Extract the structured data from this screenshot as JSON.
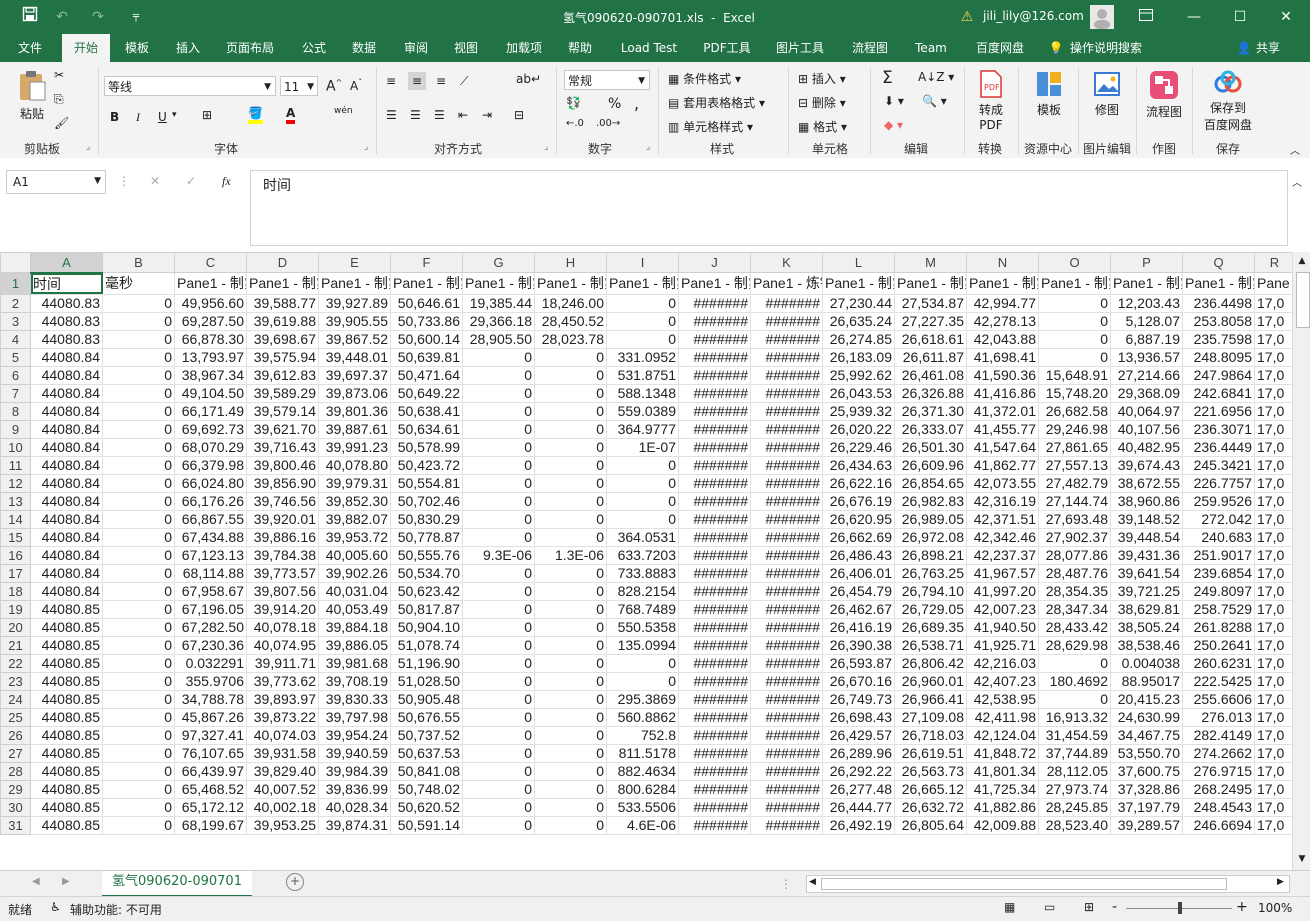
{
  "app": {
    "file_title": "氢气090620-090701.xls",
    "app_name": "Excel",
    "title_sep": "-",
    "account": "jili_lily@126.com",
    "qat_dropdown": "╤"
  },
  "tabs": [
    "文件",
    "开始",
    "模板",
    "插入",
    "页面布局",
    "公式",
    "数据",
    "审阅",
    "视图",
    "加载项",
    "帮助",
    "Load Test",
    "PDF工具",
    "图片工具",
    "流程图",
    "Team",
    "百度网盘"
  ],
  "tell_me": "操作说明搜索",
  "share": "共享",
  "ribbon": {
    "paste": "粘贴",
    "clipboard": "剪贴板",
    "font_name": "等线",
    "font_size": "11",
    "font_group": "字体",
    "align_group": "对齐方式",
    "number_format": "常规",
    "number_group": "数字",
    "cond_format": "条件格式",
    "table_format": "套用表格格式",
    "cell_style": "单元格样式",
    "style_group": "样式",
    "insert": "插入",
    "delete": "删除",
    "format": "格式",
    "cells_group": "单元格",
    "edit_group": "编辑",
    "to_pdf_1": "转成",
    "to_pdf_2": "PDF",
    "convert_group": "转换",
    "template": "模板",
    "resource_group": "资源中心",
    "fix_img": "修图",
    "img_edit_group": "图片编辑",
    "flowchart": "流程图",
    "draw_group": "作图",
    "save_baidu_1": "保存到",
    "save_baidu_2": "百度网盘",
    "save_group": "保存",
    "bold": "B",
    "italic": "I",
    "underline": "U",
    "percent": "%",
    "comma": ",",
    "wen": "wén",
    "sigma": "Σ"
  },
  "formula_bar": {
    "name_box": "A1",
    "fx": "fx",
    "content": "时间"
  },
  "columns": [
    "A",
    "B",
    "C",
    "D",
    "E",
    "F",
    "G",
    "H",
    "I",
    "J",
    "K",
    "L",
    "M",
    "N",
    "O",
    "P",
    "Q",
    "R"
  ],
  "header_row": [
    "时间",
    "毫秒",
    "Pane1 - 制氢",
    "Pane1 - 制氢",
    "Pane1 - 制氢",
    "Pane1 - 制氢",
    "Pane1 - 制氢",
    "Pane1 - 制氢",
    "Pane1 - 制氢",
    "Pane1 - 制氢",
    "Pane1 - 炼钢",
    "Pane1 - 制氢",
    "Pane1 - 制氢",
    "Pane1 - 制氢",
    "Pane1 - 制氢",
    "Pane1 - 制氢",
    "Pane1 - 制氢",
    "Pane"
  ],
  "rows": [
    [
      "44080.83",
      "0",
      "49,956.60",
      "39,588.77",
      "39,927.89",
      "50,646.61",
      "19,385.44",
      "18,246.00",
      "0",
      "#######",
      "#######",
      "27,230.44",
      "27,534.87",
      "42,994.77",
      "0",
      "12,203.43",
      "236.4498",
      "17,0"
    ],
    [
      "44080.83",
      "0",
      "69,287.50",
      "39,619.88",
      "39,905.55",
      "50,733.86",
      "29,366.18",
      "28,450.52",
      "0",
      "#######",
      "#######",
      "26,635.24",
      "27,227.35",
      "42,278.13",
      "0",
      "5,128.07",
      "253.8058",
      "17,0"
    ],
    [
      "44080.83",
      "0",
      "66,878.30",
      "39,698.67",
      "39,867.52",
      "50,600.14",
      "28,905.50",
      "28,023.78",
      "0",
      "#######",
      "#######",
      "26,274.85",
      "26,618.61",
      "42,043.88",
      "0",
      "6,887.19",
      "235.7598",
      "17,0"
    ],
    [
      "44080.84",
      "0",
      "13,793.97",
      "39,575.94",
      "39,448.01",
      "50,639.81",
      "0",
      "0",
      "331.0952",
      "#######",
      "#######",
      "26,183.09",
      "26,611.87",
      "41,698.41",
      "0",
      "13,936.57",
      "248.8095",
      "17,0"
    ],
    [
      "44080.84",
      "0",
      "38,967.34",
      "39,612.83",
      "39,697.37",
      "50,471.64",
      "0",
      "0",
      "531.8751",
      "#######",
      "#######",
      "25,992.62",
      "26,461.08",
      "41,590.36",
      "15,648.91",
      "27,214.66",
      "247.9864",
      "17,0"
    ],
    [
      "44080.84",
      "0",
      "49,104.50",
      "39,589.29",
      "39,873.06",
      "50,649.22",
      "0",
      "0",
      "588.1348",
      "#######",
      "#######",
      "26,043.53",
      "26,326.88",
      "41,416.86",
      "15,748.20",
      "29,368.09",
      "242.6841",
      "17,0"
    ],
    [
      "44080.84",
      "0",
      "66,171.49",
      "39,579.14",
      "39,801.36",
      "50,638.41",
      "0",
      "0",
      "559.0389",
      "#######",
      "#######",
      "25,939.32",
      "26,371.30",
      "41,372.01",
      "26,682.58",
      "40,064.97",
      "221.6956",
      "17,0"
    ],
    [
      "44080.84",
      "0",
      "69,692.73",
      "39,621.70",
      "39,887.61",
      "50,634.61",
      "0",
      "0",
      "364.9777",
      "#######",
      "#######",
      "26,020.22",
      "26,333.07",
      "41,455.77",
      "29,246.98",
      "40,107.56",
      "236.3071",
      "17,0"
    ],
    [
      "44080.84",
      "0",
      "68,070.29",
      "39,716.43",
      "39,991.23",
      "50,578.99",
      "0",
      "0",
      "1E-07",
      "#######",
      "#######",
      "26,229.46",
      "26,501.30",
      "41,547.64",
      "27,861.65",
      "40,482.95",
      "236.4449",
      "17,0"
    ],
    [
      "44080.84",
      "0",
      "66,379.98",
      "39,800.46",
      "40,078.80",
      "50,423.72",
      "0",
      "0",
      "0",
      "#######",
      "#######",
      "26,434.63",
      "26,609.96",
      "41,862.77",
      "27,557.13",
      "39,674.43",
      "245.3421",
      "17,0"
    ],
    [
      "44080.84",
      "0",
      "66,024.80",
      "39,856.90",
      "39,979.31",
      "50,554.81",
      "0",
      "0",
      "0",
      "#######",
      "#######",
      "26,622.16",
      "26,854.65",
      "42,073.55",
      "27,482.79",
      "38,672.55",
      "226.7757",
      "17,0"
    ],
    [
      "44080.84",
      "0",
      "66,176.26",
      "39,746.56",
      "39,852.30",
      "50,702.46",
      "0",
      "0",
      "0",
      "#######",
      "#######",
      "26,676.19",
      "26,982.83",
      "42,316.19",
      "27,144.74",
      "38,960.86",
      "259.9526",
      "17,0"
    ],
    [
      "44080.84",
      "0",
      "66,867.55",
      "39,920.01",
      "39,882.07",
      "50,830.29",
      "0",
      "0",
      "0",
      "#######",
      "#######",
      "26,620.95",
      "26,989.05",
      "42,371.51",
      "27,693.48",
      "39,148.52",
      "272.042",
      "17,0"
    ],
    [
      "44080.84",
      "0",
      "67,434.88",
      "39,886.16",
      "39,953.72",
      "50,778.87",
      "0",
      "0",
      "364.0531",
      "#######",
      "#######",
      "26,662.69",
      "26,972.08",
      "42,342.46",
      "27,902.37",
      "39,448.54",
      "240.683",
      "17,0"
    ],
    [
      "44080.84",
      "0",
      "67,123.13",
      "39,784.38",
      "40,005.60",
      "50,555.76",
      "9.3E-06",
      "1.3E-06",
      "633.7203",
      "#######",
      "#######",
      "26,486.43",
      "26,898.21",
      "42,237.37",
      "28,077.86",
      "39,431.36",
      "251.9017",
      "17,0"
    ],
    [
      "44080.84",
      "0",
      "68,114.88",
      "39,773.57",
      "39,902.26",
      "50,534.70",
      "0",
      "0",
      "733.8883",
      "#######",
      "#######",
      "26,406.01",
      "26,763.25",
      "41,967.57",
      "28,487.76",
      "39,641.54",
      "239.6854",
      "17,0"
    ],
    [
      "44080.84",
      "0",
      "67,958.67",
      "39,807.56",
      "40,031.04",
      "50,623.42",
      "0",
      "0",
      "828.2154",
      "#######",
      "#######",
      "26,454.79",
      "26,794.10",
      "41,997.20",
      "28,354.35",
      "39,721.25",
      "249.8097",
      "17,0"
    ],
    [
      "44080.85",
      "0",
      "67,196.05",
      "39,914.20",
      "40,053.49",
      "50,817.87",
      "0",
      "0",
      "768.7489",
      "#######",
      "#######",
      "26,462.67",
      "26,729.05",
      "42,007.23",
      "28,347.34",
      "38,629.81",
      "258.7529",
      "17,0"
    ],
    [
      "44080.85",
      "0",
      "67,282.50",
      "40,078.18",
      "39,884.18",
      "50,904.10",
      "0",
      "0",
      "550.5358",
      "#######",
      "#######",
      "26,416.19",
      "26,689.35",
      "41,940.50",
      "28,433.42",
      "38,505.24",
      "261.8288",
      "17,0"
    ],
    [
      "44080.85",
      "0",
      "67,230.36",
      "40,074.95",
      "39,886.05",
      "51,078.74",
      "0",
      "0",
      "135.0994",
      "#######",
      "#######",
      "26,390.38",
      "26,538.71",
      "41,925.71",
      "28,629.98",
      "38,538.46",
      "250.2641",
      "17,0"
    ],
    [
      "44080.85",
      "0",
      "0.032291",
      "39,911.71",
      "39,981.68",
      "51,196.90",
      "0",
      "0",
      "0",
      "#######",
      "#######",
      "26,593.87",
      "26,806.42",
      "42,216.03",
      "0",
      "0.004038",
      "260.6231",
      "17,0"
    ],
    [
      "44080.85",
      "0",
      "355.9706",
      "39,773.62",
      "39,708.19",
      "51,028.50",
      "0",
      "0",
      "0",
      "#######",
      "#######",
      "26,670.16",
      "26,960.01",
      "42,407.23",
      "180.4692",
      "88.95017",
      "222.5425",
      "17,0"
    ],
    [
      "44080.85",
      "0",
      "34,788.78",
      "39,893.97",
      "39,830.33",
      "50,905.48",
      "0",
      "0",
      "295.3869",
      "#######",
      "#######",
      "26,749.73",
      "26,966.41",
      "42,538.95",
      "0",
      "20,415.23",
      "255.6606",
      "17,0"
    ],
    [
      "44080.85",
      "0",
      "45,867.26",
      "39,873.22",
      "39,797.98",
      "50,676.55",
      "0",
      "0",
      "560.8862",
      "#######",
      "#######",
      "26,698.43",
      "27,109.08",
      "42,411.98",
      "16,913.32",
      "24,630.99",
      "276.013",
      "17,0"
    ],
    [
      "44080.85",
      "0",
      "97,327.41",
      "40,074.03",
      "39,954.24",
      "50,737.52",
      "0",
      "0",
      "752.8",
      "#######",
      "#######",
      "26,429.57",
      "26,718.03",
      "42,124.04",
      "31,454.59",
      "34,467.75",
      "282.4149",
      "17,0"
    ],
    [
      "44080.85",
      "0",
      "76,107.65",
      "39,931.58",
      "39,940.59",
      "50,637.53",
      "0",
      "0",
      "811.5178",
      "#######",
      "#######",
      "26,289.96",
      "26,619.51",
      "41,848.72",
      "37,744.89",
      "53,550.70",
      "274.2662",
      "17,0"
    ],
    [
      "44080.85",
      "0",
      "66,439.97",
      "39,829.40",
      "39,984.39",
      "50,841.08",
      "0",
      "0",
      "882.4634",
      "#######",
      "#######",
      "26,292.22",
      "26,563.73",
      "41,801.34",
      "28,112.05",
      "37,600.75",
      "276.9715",
      "17,0"
    ],
    [
      "44080.85",
      "0",
      "65,468.52",
      "40,007.52",
      "39,836.99",
      "50,748.02",
      "0",
      "0",
      "800.6284",
      "#######",
      "#######",
      "26,277.48",
      "26,665.12",
      "41,725.34",
      "27,973.74",
      "37,328.86",
      "268.2495",
      "17,0"
    ],
    [
      "44080.85",
      "0",
      "65,172.12",
      "40,002.18",
      "40,028.34",
      "50,620.52",
      "0",
      "0",
      "533.5506",
      "#######",
      "#######",
      "26,444.77",
      "26,632.72",
      "41,882.86",
      "28,245.85",
      "37,197.79",
      "248.4543",
      "17,0"
    ],
    [
      "44080.85",
      "0",
      "68,199.67",
      "39,953.25",
      "39,874.31",
      "50,591.14",
      "0",
      "0",
      "4.6E-06",
      "#######",
      "#######",
      "26,492.19",
      "26,805.64",
      "42,009.88",
      "28,523.40",
      "39,289.57",
      "246.6694",
      "17,0"
    ]
  ],
  "sheet_tab": "氢气090620-090701",
  "status": {
    "ready": "就绪",
    "accessibility": "辅助功能: 不可用",
    "zoom": "100%",
    "minus": "-",
    "plus": "+"
  }
}
